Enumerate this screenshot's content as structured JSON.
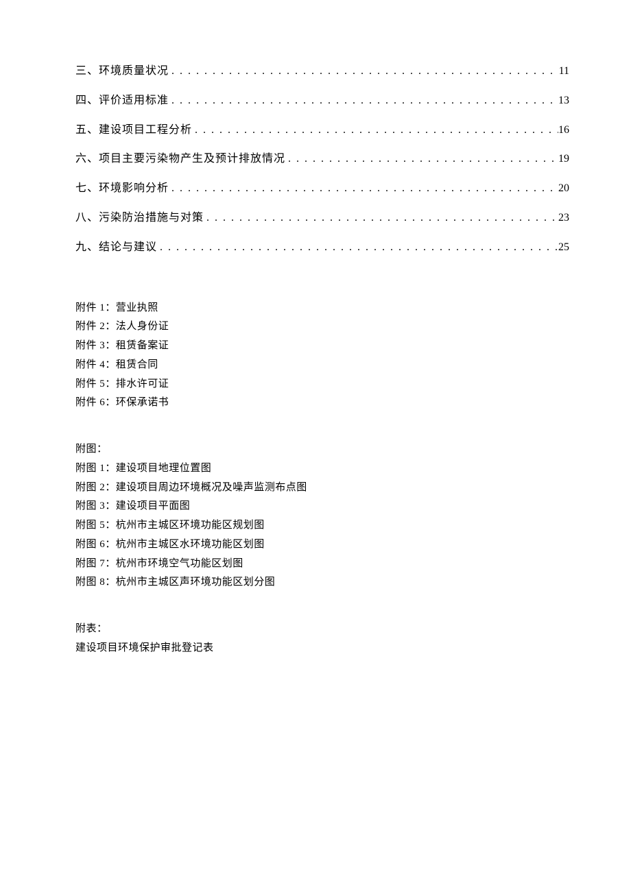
{
  "toc": [
    {
      "title": "三、环境质量状况",
      "page": "11"
    },
    {
      "title": "四、评价适用标准",
      "page": "13"
    },
    {
      "title": "五、建设项目工程分析",
      "page": "16"
    },
    {
      "title": "六、项目主要污染物产生及预计排放情况",
      "page": "19"
    },
    {
      "title": "七、环境影响分析",
      "page": "20"
    },
    {
      "title": "八、污染防治措施与对策",
      "page": "23"
    },
    {
      "title": "九、结论与建议",
      "page": "25"
    }
  ],
  "attachments": [
    "附件 1：营业执照",
    "附件 2：法人身份证",
    "附件 3：租赁备案证",
    "附件 4：租赁合同",
    "附件 5：排水许可证",
    "附件 6：环保承诺书"
  ],
  "figures_header": "附图：",
  "figures": [
    "附图 1：建设项目地理位置图",
    "附图 2：建设项目周边环境概况及噪声监测布点图",
    "附图 3：建设项目平面图",
    "附图 5：杭州市主城区环境功能区规划图",
    "附图 6：杭州市主城区水环境功能区划图",
    "附图 7：杭州市环境空气功能区划图",
    "附图 8：杭州市主城区声环境功能区划分图"
  ],
  "tables_header": "附表：",
  "tables": [
    "建设项目环境保护审批登记表"
  ],
  "dots": ". . . . . . . . . . . . . . . . . . . . . . . . . . . . . . . . . . . . . . . . . . . . . . . . . . . . . . . . . . . . . . . . . . . . . . . . . . . . . . . . . . . . . . . . . . . . . . . . . . . ."
}
